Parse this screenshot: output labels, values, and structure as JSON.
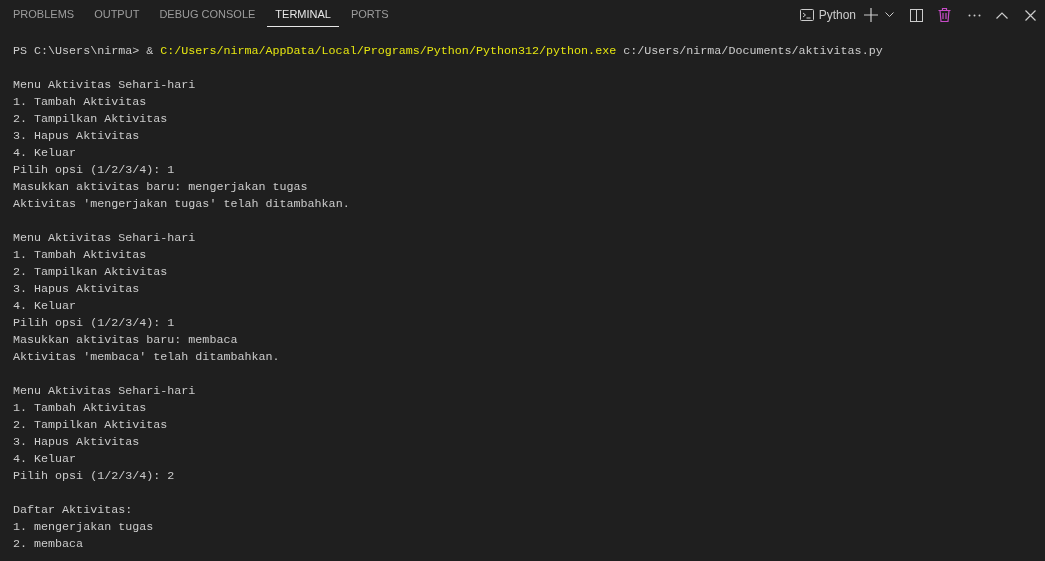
{
  "tabs": [
    {
      "label": "PROBLEMS",
      "selected": false
    },
    {
      "label": "OUTPUT",
      "selected": false
    },
    {
      "label": "DEBUG CONSOLE",
      "selected": false
    },
    {
      "label": "TERMINAL",
      "selected": true
    },
    {
      "label": "PORTS",
      "selected": false
    }
  ],
  "terminal_picker": {
    "label": "Python"
  },
  "command": {
    "prompt": "PS C:\\Users\\nirma> &",
    "executable": "C:/Users/nirma/AppData/Local/Programs/Python/Python312/python.exe",
    "argument": "c:/Users/nirma/Documents/aktivitas.py"
  },
  "output_blocks": [
    [
      "Menu Aktivitas Sehari-hari",
      "1. Tambah Aktivitas",
      "2. Tampilkan Aktivitas",
      "3. Hapus Aktivitas",
      "4. Keluar",
      "Pilih opsi (1/2/3/4): 1",
      "Masukkan aktivitas baru: mengerjakan tugas",
      "Aktivitas 'mengerjakan tugas' telah ditambahkan."
    ],
    [
      "Menu Aktivitas Sehari-hari",
      "1. Tambah Aktivitas",
      "2. Tampilkan Aktivitas",
      "3. Hapus Aktivitas",
      "4. Keluar",
      "Pilih opsi (1/2/3/4): 1",
      "Masukkan aktivitas baru: membaca",
      "Aktivitas 'membaca' telah ditambahkan."
    ],
    [
      "Menu Aktivitas Sehari-hari",
      "1. Tambah Aktivitas",
      "2. Tampilkan Aktivitas",
      "3. Hapus Aktivitas",
      "4. Keluar",
      "Pilih opsi (1/2/3/4): 2"
    ],
    [
      "Daftar Aktivitas:",
      "1. mengerjakan tugas",
      "2. membaca"
    ]
  ]
}
